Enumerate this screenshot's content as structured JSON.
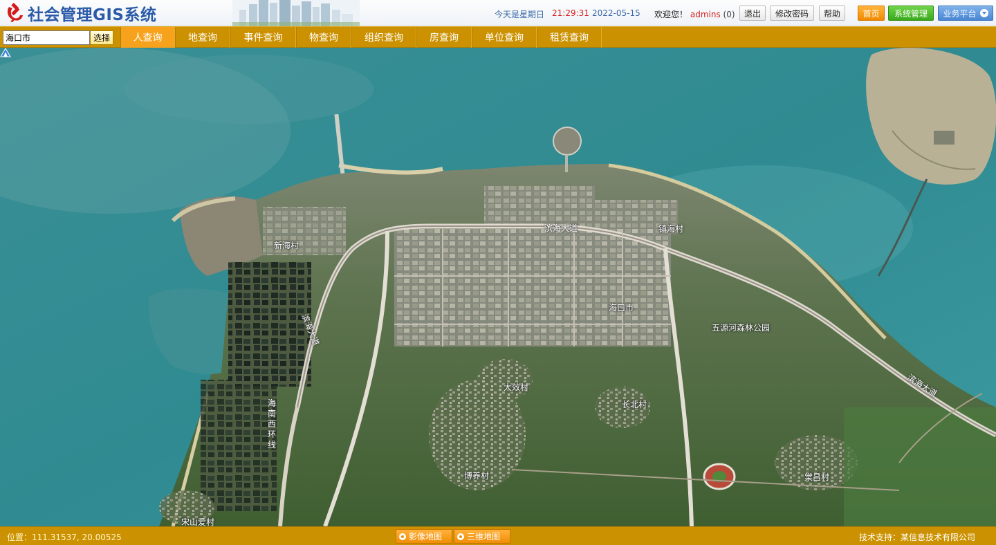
{
  "app": {
    "title": "社会管理GIS系统"
  },
  "header": {
    "weekday": "今天是星期日",
    "time": "21:29:31",
    "date": "2022-05-15",
    "welcome_prefix": "欢迎您！",
    "user": "admins",
    "message_count": "(0)",
    "buttons": {
      "logout": "退出",
      "change_password": "修改密码",
      "help": "帮助",
      "home": "首页",
      "system": "系统管理",
      "business": "业务平台"
    }
  },
  "nav": {
    "city_value": "海口市",
    "select_label": "选择",
    "tabs": [
      {
        "label": "人查询",
        "active": true
      },
      {
        "label": "地查询",
        "active": false
      },
      {
        "label": "事件查询",
        "active": false
      },
      {
        "label": "物查询",
        "active": false
      },
      {
        "label": "组织查询",
        "active": false
      },
      {
        "label": "房查询",
        "active": false
      },
      {
        "label": "单位查询",
        "active": false
      },
      {
        "label": "租赁查询",
        "active": false
      }
    ]
  },
  "map": {
    "places": {
      "xinhai": "新海村",
      "jiehai": "镇海村",
      "haikou": "海口市",
      "wuyuan_park": "五源河森林公园",
      "dazhi": "大效村",
      "changbei": "长北村",
      "boyang": "博养村",
      "tangchang": "棠昌村",
      "songshan": "宋山爱村"
    },
    "roads": {
      "binhai_top": "滨海大道",
      "binhai_west": "滨海大道",
      "binhai_east": "滨海大道",
      "hainan_west_ring": "海南西环线"
    }
  },
  "status": {
    "position_label": "位置：",
    "coordinates": "111.31537, 20.00525",
    "image_map": "影像地图",
    "map_3d": "三维地图",
    "support": "技术支持：某信息技术有限公司"
  },
  "colors": {
    "nav_bar": "#cc9100",
    "active_tab": "#f7a21d",
    "title_blue": "#2a5aa8",
    "sea": "#2f8c93",
    "land": "#4b6b3a"
  }
}
